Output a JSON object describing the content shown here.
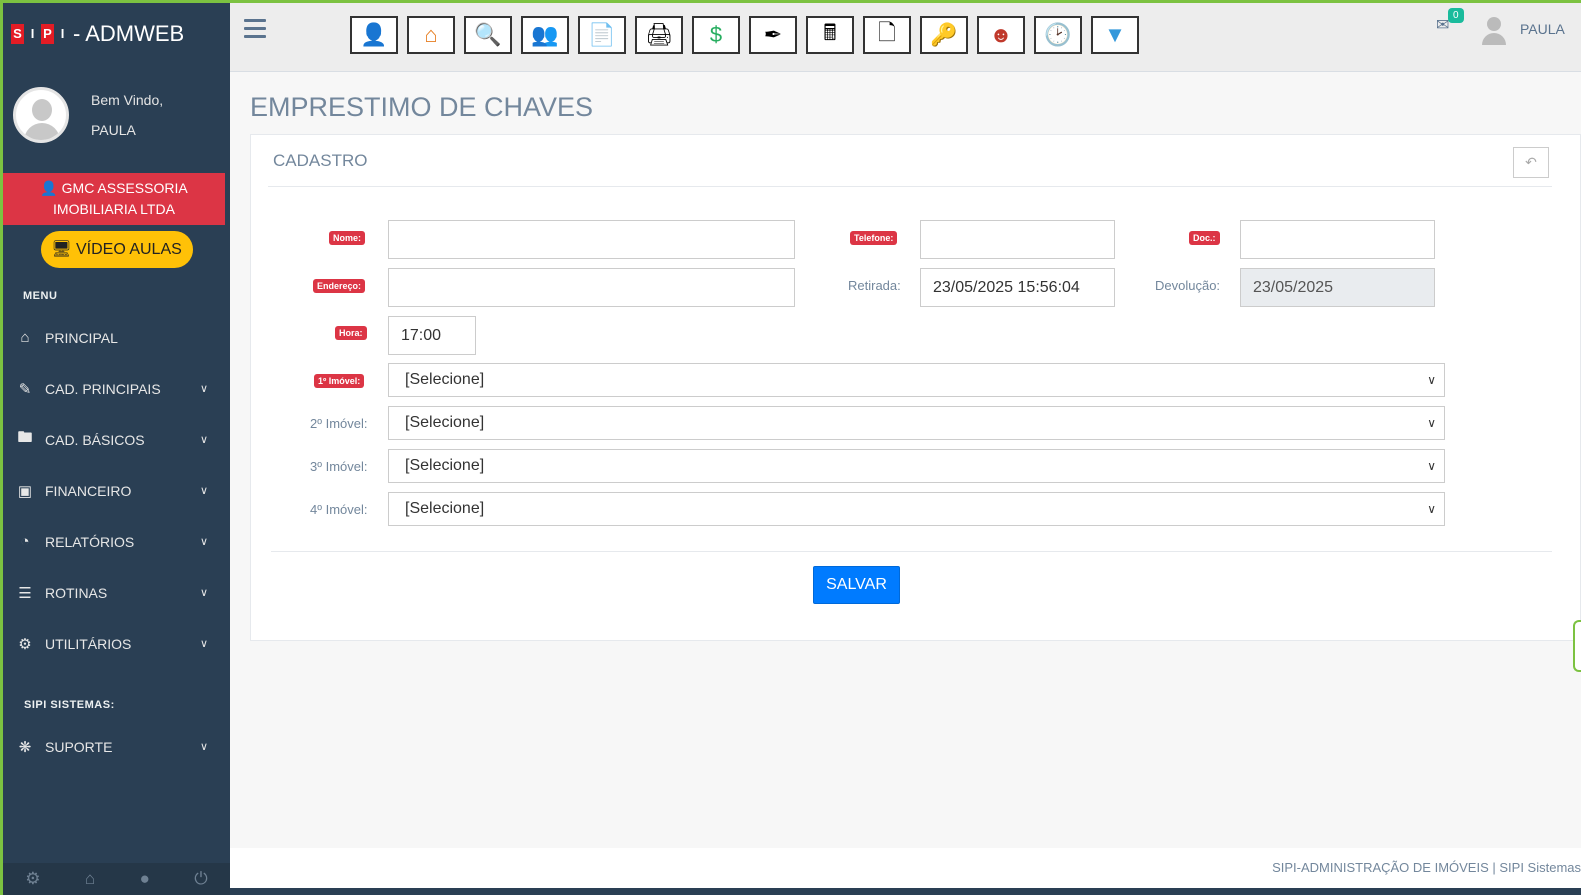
{
  "brand": {
    "letters": [
      "S",
      "I",
      "P",
      "I"
    ],
    "title": "- ADMWEB"
  },
  "profile": {
    "welcome": "Bem Vindo,",
    "name": "PAULA"
  },
  "company": {
    "icon": "user-icon",
    "name": "GMC ASSESSORIA IMOBILIARIA LTDA"
  },
  "video": {
    "icon": "monitor-icon",
    "label": "VÍDEO AULAS"
  },
  "menu": {
    "title": "MENU",
    "items": [
      {
        "icon": "home-icon",
        "label": "PRINCIPAL",
        "expandable": false
      },
      {
        "icon": "edit-icon",
        "label": "CAD. PRINCIPAIS",
        "expandable": true
      },
      {
        "icon": "folder-icon",
        "label": "CAD. BÁSICOS",
        "expandable": true
      },
      {
        "icon": "money-icon",
        "label": "FINANCEIRO",
        "expandable": true
      },
      {
        "icon": "pie-chart-icon",
        "label": "RELATÓRIOS",
        "expandable": true
      },
      {
        "icon": "database-icon",
        "label": "ROTINAS",
        "expandable": true
      },
      {
        "icon": "gear-icon",
        "label": "UTILITÁRIOS",
        "expandable": true
      }
    ],
    "support_title": "SIPI SISTEMAS:",
    "support": {
      "icon": "bug-icon",
      "label": "SUPORTE"
    }
  },
  "sidebar_footer": [
    "gear-icon",
    "home-icon",
    "user-icon",
    "power-icon"
  ],
  "toolbar": [
    "owner-user-icon",
    "house-icon",
    "search-key-icon",
    "group-icon",
    "contract-icon",
    "printer-icon",
    "money-add-icon",
    "pen-icon",
    "calculator-icon",
    "documents-icon",
    "keys-icon",
    "attendant-icon",
    "calendar-clock-icon",
    "filter-icon"
  ],
  "topbar": {
    "mail_count": "0",
    "user": "PAULA"
  },
  "page": {
    "title": "EMPRESTIMO DE CHAVES"
  },
  "panel": {
    "title": "CADASTRO",
    "labels": {
      "nome": "Nome:",
      "telefone": "Telefone:",
      "doc": "Doc.:",
      "endereco": "Endereço:",
      "retirada": "Retirada:",
      "devolucao": "Devolução:",
      "hora": "Hora:",
      "imovel1": "1º Imóvel:",
      "imovel2": "2º Imóvel:",
      "imovel3": "3º Imóvel:",
      "imovel4": "4º Imóvel:"
    },
    "values": {
      "nome": "",
      "telefone": "",
      "doc": "",
      "endereco": "",
      "retirada": "23/05/2025 15:56:04",
      "devolucao": "23/05/2025",
      "hora": "17:00",
      "imovel1": "[Selecione]",
      "imovel2": "[Selecione]",
      "imovel3": "[Selecione]",
      "imovel4": "[Selecione]"
    },
    "save": "SALVAR"
  },
  "footer": {
    "text": "SIPI-ADMINISTRAÇÃO DE IMÓVEIS | SIPI Sistemas"
  }
}
